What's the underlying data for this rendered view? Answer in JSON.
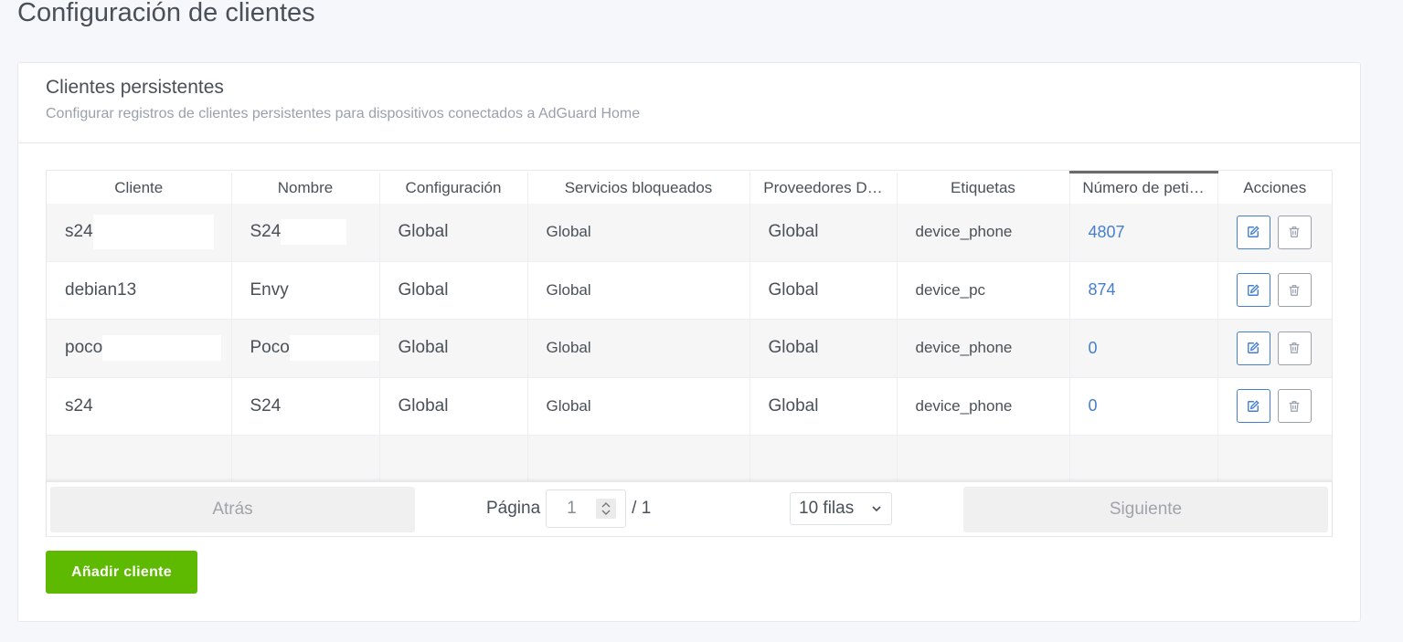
{
  "page": {
    "title": "Configuración de clientes"
  },
  "card": {
    "title": "Clientes persistentes",
    "subtitle": "Configurar registros de clientes persistentes para dispositivos conectados a AdGuard Home"
  },
  "table": {
    "columns": [
      "Cliente",
      "Nombre",
      "Configuración",
      "Servicios bloqueados",
      "Proveedores D…",
      "Etiquetas",
      "Número de peti…",
      "Acciones"
    ],
    "rows": [
      {
        "client": "s24",
        "name": "S24",
        "config": "Global",
        "services": "Global",
        "providers": "Global",
        "tags": "device_phone",
        "requests": "4807"
      },
      {
        "client": "debian13",
        "name": "Envy",
        "config": "Global",
        "services": "Global",
        "providers": "Global",
        "tags": "device_pc",
        "requests": "874"
      },
      {
        "client": "poco",
        "name": "Poco",
        "config": "Global",
        "services": "Global",
        "providers": "Global",
        "tags": "device_phone",
        "requests": "0"
      },
      {
        "client": "s24",
        "name": "S24",
        "config": "Global",
        "services": "Global",
        "providers": "Global",
        "tags": "device_phone",
        "requests": "0"
      }
    ]
  },
  "pagination": {
    "prev_label": "Atrás",
    "page_label": "Página",
    "page_value": "1",
    "total": "/ 1",
    "rows_option": "10 filas",
    "next_label": "Siguiente"
  },
  "add_button": "Añadir cliente",
  "icons": {
    "edit": "edit-icon",
    "delete": "trash-icon",
    "spinner": "spinner-icon",
    "dropdown": "chevron-down-icon"
  },
  "colors": {
    "accent": "#467fcf",
    "success": "#5eba00"
  }
}
